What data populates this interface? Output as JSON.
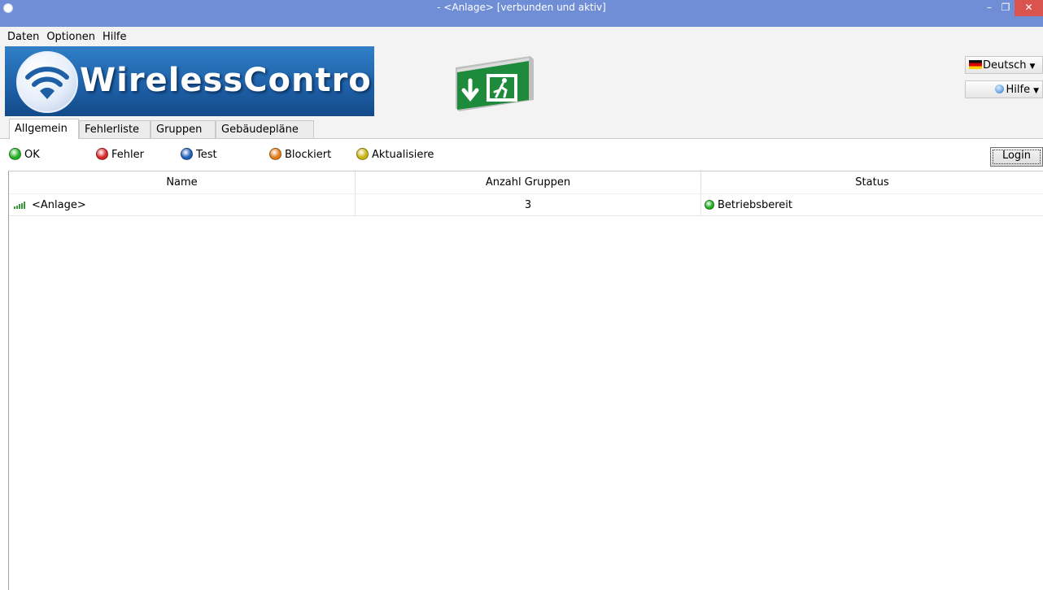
{
  "window": {
    "title": "- <Anlage> [verbunden und aktiv]",
    "minimize_glyph": "–",
    "maximize_glyph": "❐",
    "close_glyph": "✕"
  },
  "menu": {
    "items": [
      "Daten",
      "Optionen",
      "Hilfe"
    ]
  },
  "banner": {
    "logo_text": "WirelessControl",
    "language_label": "Deutsch",
    "help_label": "Hilfe",
    "dropdown_caret": "▼"
  },
  "tabs": [
    {
      "label": "Allgemein",
      "active": true
    },
    {
      "label": "Fehlerliste",
      "active": false
    },
    {
      "label": "Gruppen",
      "active": false
    },
    {
      "label": "Gebäudepläne",
      "active": false
    }
  ],
  "legend": [
    {
      "label": "OK",
      "color": "#22b022"
    },
    {
      "label": "Fehler",
      "color": "#d62626"
    },
    {
      "label": "Test",
      "color": "#1f5fb8"
    },
    {
      "label": "Blockiert",
      "color": "#e07a1a"
    },
    {
      "label": "Aktualisiere",
      "color": "#c9b20e"
    }
  ],
  "login_label": "Login",
  "table": {
    "headers": {
      "name": "Name",
      "groups": "Anzahl Gruppen",
      "status": "Status"
    },
    "rows": [
      {
        "name": "<Anlage>",
        "groups": "3",
        "status": "Betriebsbereit",
        "status_color": "#22b022"
      }
    ]
  }
}
